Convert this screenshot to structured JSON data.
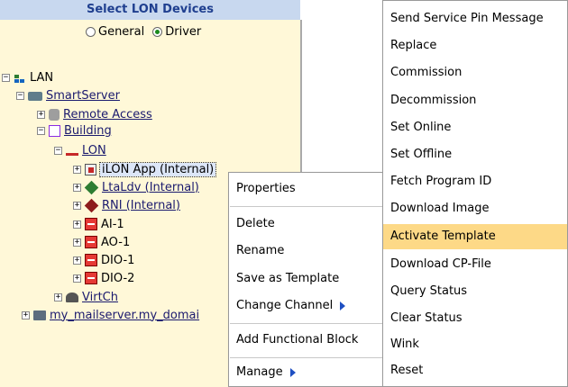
{
  "panel": {
    "header": "Select LON Devices",
    "mode_general": "General",
    "mode_driver": "Driver"
  },
  "tree": {
    "lan": "LAN",
    "smartserver": "SmartServer",
    "remote_access": "Remote Access",
    "building": "Building",
    "lon": "LON",
    "ilon_app": "iLON App (Internal)",
    "ltaldv": "LtaLdv (Internal)",
    "rni": "RNI (Internal)",
    "ai1": "AI-1",
    "ao1": "AO-1",
    "dio1": "DIO-1",
    "dio2": "DIO-2",
    "virtch": "VirtCh",
    "mailserver": "my_mailserver.my_domai"
  },
  "context_menu": {
    "properties": "Properties",
    "delete": "Delete",
    "rename": "Rename",
    "save_template": "Save as Template",
    "change_channel": "Change Channel",
    "add_fb": "Add Functional Block",
    "manage": "Manage"
  },
  "submenu": {
    "items": [
      "Send Service Pin Message",
      "Replace",
      "Commission",
      "Decommission",
      "Set Online",
      "Set Offline",
      "Fetch Program ID",
      "Download Image",
      "Activate Template",
      "Download CP-File",
      "Query Status",
      "Clear Status",
      "Wink",
      "Reset"
    ],
    "highlighted": "Activate Template"
  },
  "colors": {
    "panel_bg": "#fff8d8",
    "header_bg": "#c8d8ef",
    "highlight": "#fdd987",
    "arrow": "#1e4fc2"
  }
}
